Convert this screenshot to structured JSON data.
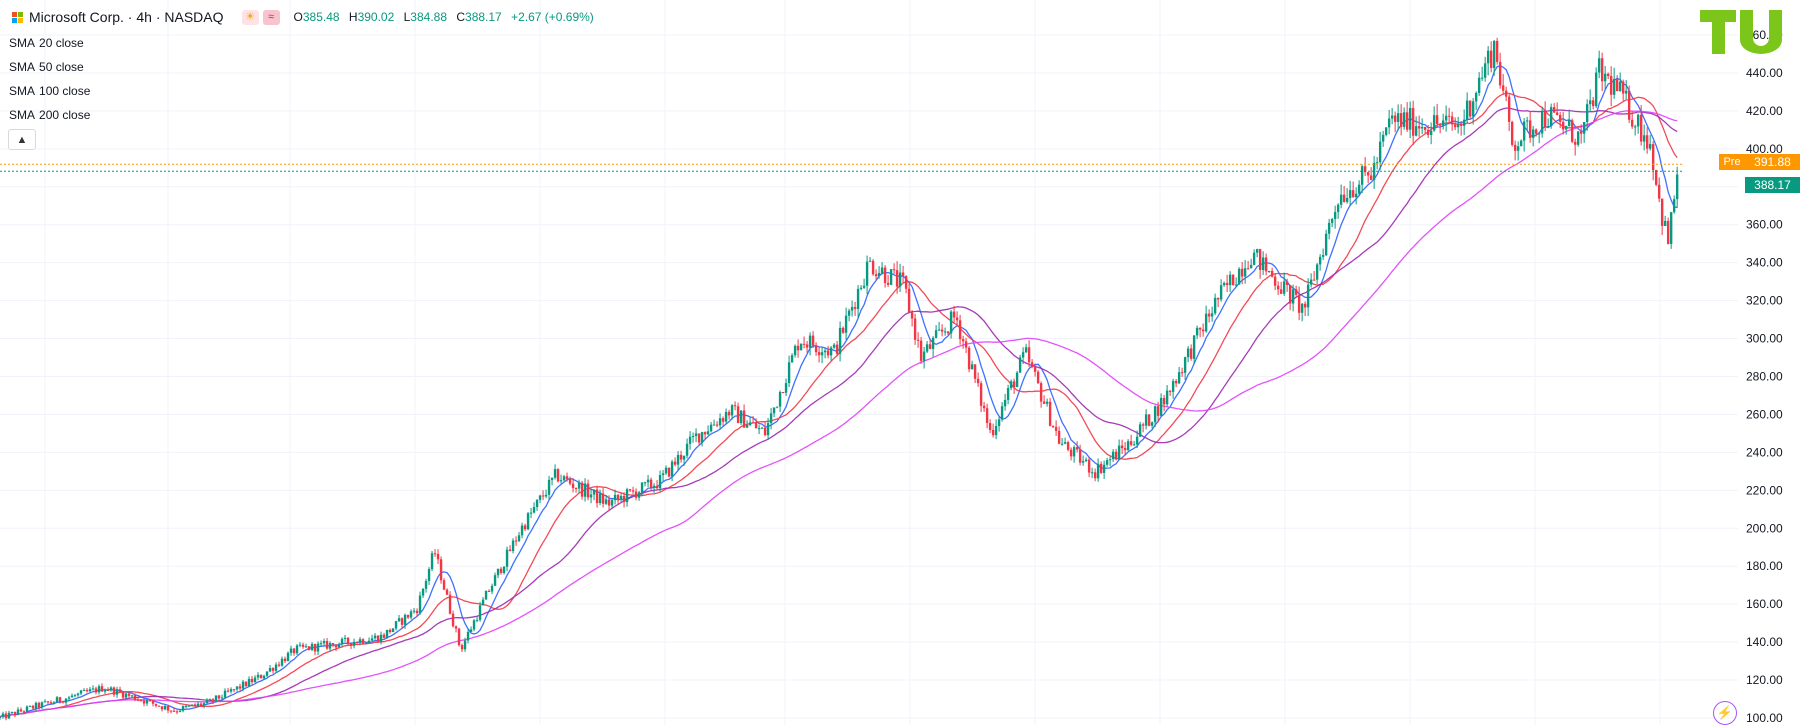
{
  "header": {
    "title": "Microsoft Corp. · 4h · NASDAQ",
    "ohlc": {
      "o_label": "O",
      "o": "385.48",
      "h_label": "H",
      "h": "390.02",
      "l_label": "L",
      "l": "384.88",
      "c_label": "C",
      "c": "388.17",
      "change": "+2.67 (+0.69%)"
    },
    "badges": {
      "sun": "☀",
      "wave": "≈"
    }
  },
  "indicators": [
    {
      "kind": "SMA",
      "params": "20 close",
      "color": "#2962ff"
    },
    {
      "kind": "SMA",
      "params": "50 close",
      "color": "#f23645"
    },
    {
      "kind": "SMA",
      "params": "100 close",
      "color": "#9c27b0"
    },
    {
      "kind": "SMA",
      "params": "200 close",
      "color": "#e040fb"
    }
  ],
  "collapse_icon": "chevron-up-icon",
  "price_labels": {
    "pre_tag": "Pre",
    "pre_price": "391.88",
    "last_price": "388.17",
    "pre_color": "#ff9800",
    "last_color": "#089981"
  },
  "colors": {
    "up": "#089981",
    "down": "#f23645",
    "grid": "#f0f3fa"
  },
  "chart_data": {
    "type": "candlestick",
    "title": "Microsoft Corp. · 4h · NASDAQ",
    "y_axis": {
      "ticks": [
        "100.00",
        "120.00",
        "140.00",
        "160.00",
        "180.00",
        "200.00",
        "220.00",
        "240.00",
        "260.00",
        "280.00",
        "300.00",
        "320.00",
        "340.00",
        "360.00",
        "380.00",
        "400.00",
        "420.00",
        "440.00",
        "460.00"
      ],
      "ylim": [
        100,
        463
      ]
    },
    "grid": true,
    "price_path": [
      [
        0,
        100
      ],
      [
        0.02,
        106
      ],
      [
        0.06,
        116
      ],
      [
        0.08,
        110
      ],
      [
        0.1,
        104
      ],
      [
        0.12,
        108
      ],
      [
        0.15,
        122
      ],
      [
        0.17,
        136
      ],
      [
        0.2,
        140
      ],
      [
        0.22,
        143
      ],
      [
        0.24,
        158
      ],
      [
        0.25,
        188
      ],
      [
        0.265,
        136
      ],
      [
        0.28,
        165
      ],
      [
        0.3,
        200
      ],
      [
        0.32,
        228
      ],
      [
        0.35,
        213
      ],
      [
        0.38,
        225
      ],
      [
        0.4,
        248
      ],
      [
        0.42,
        262
      ],
      [
        0.44,
        250
      ],
      [
        0.46,
        300
      ],
      [
        0.48,
        293
      ],
      [
        0.5,
        340
      ],
      [
        0.52,
        328
      ],
      [
        0.53,
        290
      ],
      [
        0.55,
        312
      ],
      [
        0.57,
        250
      ],
      [
        0.59,
        292
      ],
      [
        0.61,
        245
      ],
      [
        0.63,
        230
      ],
      [
        0.65,
        245
      ],
      [
        0.67,
        268
      ],
      [
        0.7,
        320
      ],
      [
        0.72,
        345
      ],
      [
        0.75,
        315
      ],
      [
        0.77,
        375
      ],
      [
        0.79,
        388
      ],
      [
        0.8,
        415
      ],
      [
        0.84,
        412
      ],
      [
        0.86,
        455
      ],
      [
        0.87,
        403
      ],
      [
        0.89,
        418
      ],
      [
        0.91,
        405
      ],
      [
        0.92,
        440
      ],
      [
        0.93,
        432
      ],
      [
        0.95,
        402
      ],
      [
        0.955,
        370
      ],
      [
        0.96,
        350
      ],
      [
        0.965,
        388
      ]
    ],
    "sma_lags": {
      "SMA 20": 0.006,
      "SMA 50": 0.015,
      "SMA 100": 0.03,
      "SMA 200": 0.06
    },
    "last": 388.17,
    "pre": 391.88
  }
}
